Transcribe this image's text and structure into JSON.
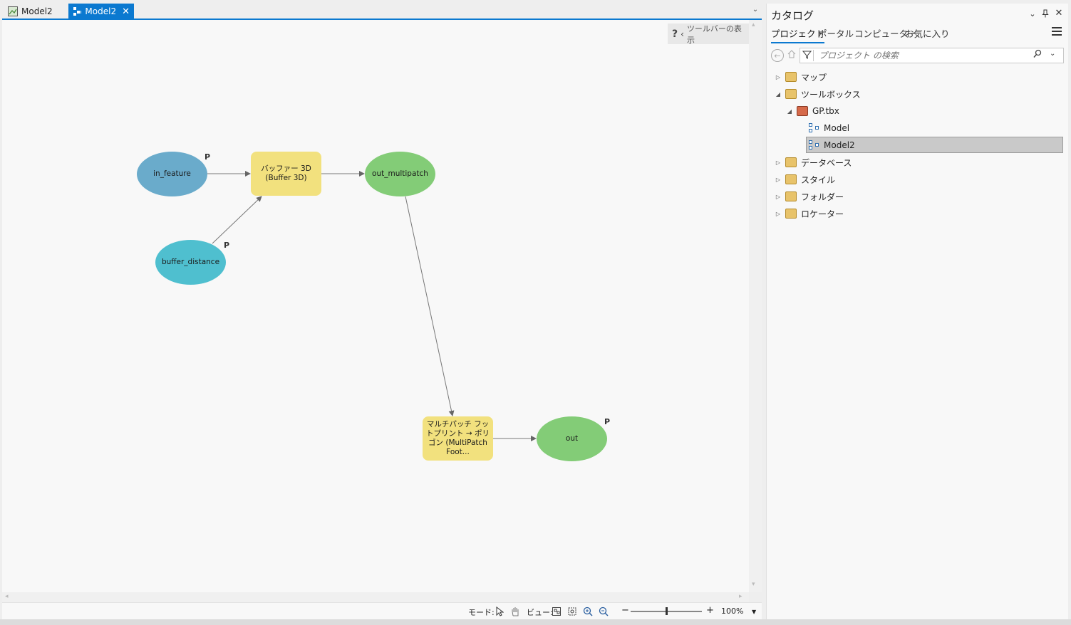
{
  "tabs": {
    "map_tab": "Model2",
    "model_tab": "Model2"
  },
  "canvas": {
    "toolbar_toggle": "ツールバーの表示",
    "nodes": {
      "in_feature": "in_feature",
      "buffer_distance": "buffer_distance",
      "buffer3d": "バッファー 3D (Buffer 3D)",
      "out_multipatch": "out_multipatch",
      "footprint": "マルチパッチ フットプリント → ポリゴン (MultiPatch Foot...",
      "out": "out"
    },
    "param_marker": "P"
  },
  "status": {
    "mode_label": "モード:",
    "view_label": "ビュー:",
    "zoom": "100%"
  },
  "catalog": {
    "title": "カタログ",
    "tabs": [
      "プロジェクト",
      "ポータル",
      "コンピューター",
      "お気に入り"
    ],
    "search_placeholder": "プロジェクト の検索",
    "tree": {
      "maps": "マップ",
      "toolboxes": "ツールボックス",
      "gp_tbx": "GP.tbx",
      "model": "Model",
      "model2": "Model2",
      "databases": "データベース",
      "styles": "スタイル",
      "folders": "フォルダー",
      "locators": "ロケーター"
    }
  },
  "colors": {
    "accent": "#0b79d0",
    "input_ellipse": "#6aabcb",
    "param_ellipse": "#4fbfcf",
    "tool_rect": "#f2e17e",
    "output_ellipse": "#83cc77"
  }
}
